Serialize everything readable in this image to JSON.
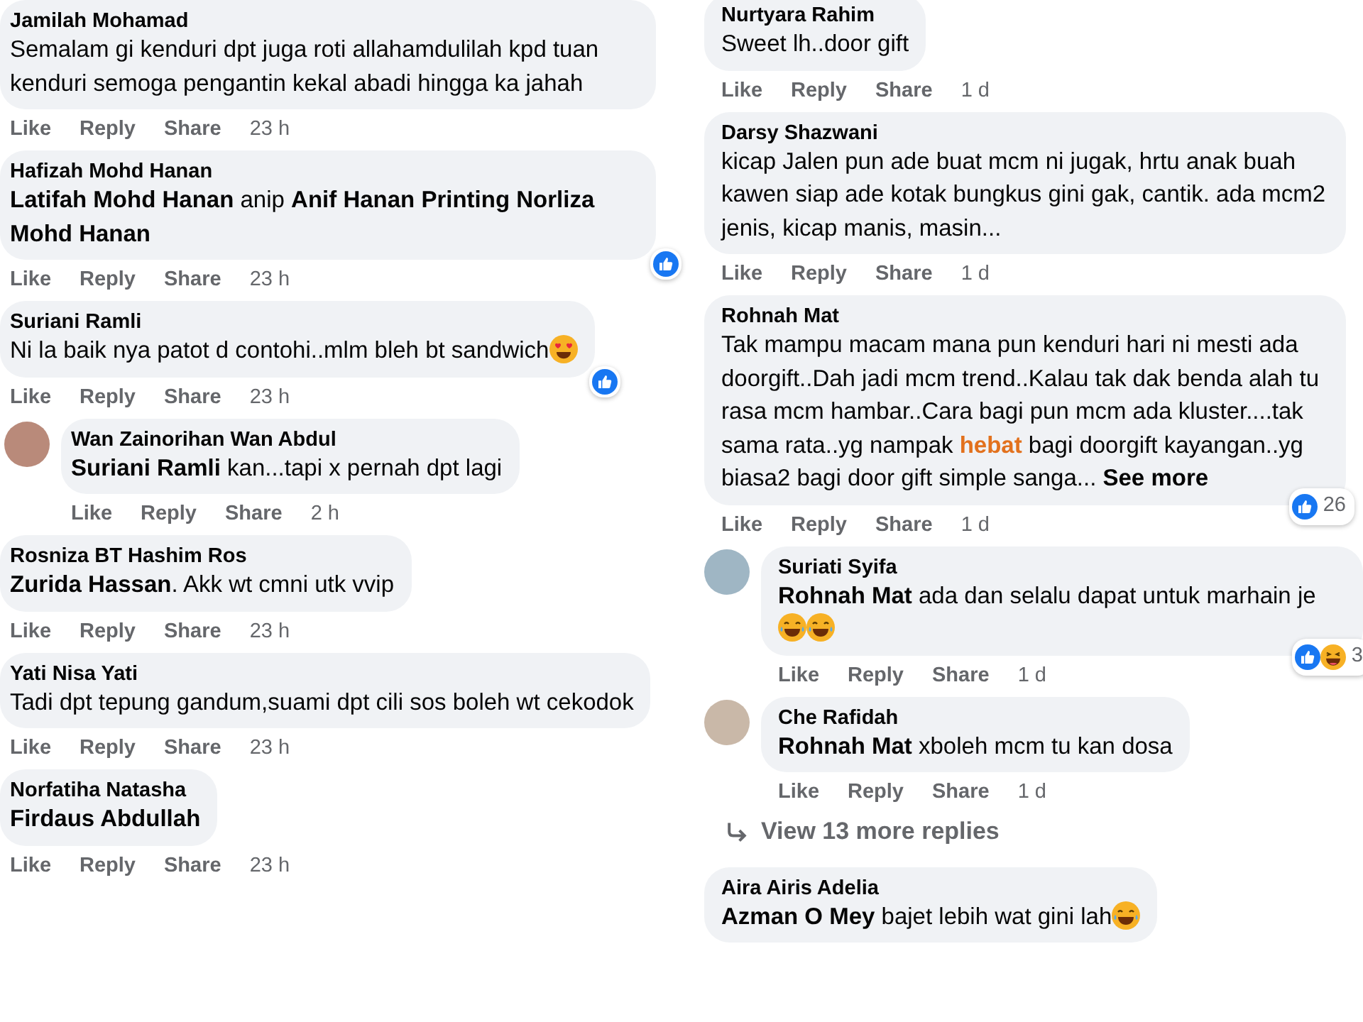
{
  "columns": [
    {
      "comments": [
        {
          "reply": false,
          "author": "Jamilah Mohamad",
          "text": [
            {
              "kind": "plain",
              "text": "Semalam gi kenduri dpt juga roti allahamdulilah kpd tuan kenduri semoga pengantin kekal abadi hingga ka jahah"
            }
          ],
          "actions": [
            "Like",
            "Reply",
            "Share"
          ],
          "time": "23 h"
        },
        {
          "reply": false,
          "author": "Hafizah Mohd Hanan",
          "text": [
            {
              "kind": "mention",
              "text": "Latifah Mohd Hanan"
            },
            {
              "kind": "plain",
              "text": " anip "
            },
            {
              "kind": "mention",
              "text": "Anif Hanan Printing Norliza Mohd Hanan"
            }
          ],
          "actions": [
            "Like",
            "Reply",
            "Share"
          ],
          "time": "23 h",
          "reactions": [
            {
              "kind": "like"
            }
          ]
        },
        {
          "reply": false,
          "author": "Suriani Ramli",
          "text": [
            {
              "kind": "plain",
              "text": "Ni la baik nya patot d contohi..mlm bleh bt sandwich"
            },
            {
              "kind": "heart_eyes_emoji"
            }
          ],
          "actions": [
            "Like",
            "Reply",
            "Share"
          ],
          "time": "23 h",
          "reactions": [
            {
              "kind": "like"
            }
          ]
        },
        {
          "reply": true,
          "author": "Wan Zainorihan Wan Abdul",
          "text": [
            {
              "kind": "mention",
              "text": "Suriani Ramli"
            },
            {
              "kind": "plain",
              "text": " kan...tapi x pernah dpt lagi"
            }
          ],
          "actions": [
            "Like",
            "Reply",
            "Share"
          ],
          "time": "2 h"
        },
        {
          "reply": false,
          "author": "Rosniza BT Hashim Ros",
          "text": [
            {
              "kind": "mention",
              "text": "Zurida Hassan"
            },
            {
              "kind": "plain",
              "text": ". Akk wt cmni utk vvip"
            }
          ],
          "actions": [
            "Like",
            "Reply",
            "Share"
          ],
          "time": "23 h"
        },
        {
          "reply": false,
          "author": "Yati Nisa Yati",
          "text": [
            {
              "kind": "plain",
              "text": "Tadi dpt tepung gandum,suami dpt cili sos boleh wt cekodok"
            }
          ],
          "actions": [
            "Like",
            "Reply",
            "Share"
          ],
          "time": "23 h"
        },
        {
          "reply": false,
          "author": "Norfatiha Natasha",
          "text": [
            {
              "kind": "mention",
              "text": "Firdaus Abdullah"
            }
          ],
          "actions": [
            "Like",
            "Reply",
            "Share"
          ],
          "time": "23 h"
        }
      ]
    },
    {
      "comments": [
        {
          "reply": false,
          "author": "Nurtyara Rahim",
          "text": [
            {
              "kind": "plain",
              "text": "Sweet lh..door gift"
            }
          ],
          "actions": [
            "Like",
            "Reply",
            "Share"
          ],
          "time": "1 d"
        },
        {
          "reply": false,
          "author": "Darsy Shazwani",
          "text": [
            {
              "kind": "plain",
              "text": "kicap Jalen pun ade buat mcm ni jugak, hrtu anak buah kawen siap ade kotak bungkus gini gak, cantik. ada mcm2 jenis, kicap manis, masin..."
            }
          ],
          "actions": [
            "Like",
            "Reply",
            "Share"
          ],
          "time": "1 d"
        },
        {
          "reply": false,
          "author": "Rohnah Mat",
          "text": [
            {
              "kind": "plain",
              "text": "Tak mampu macam mana pun kenduri hari ni mesti ada doorgift..Dah jadi mcm trend..Kalau tak dak benda alah tu rasa mcm hambar..Cara bagi pun mcm ada kluster....tak sama rata..yg nampak "
            },
            {
              "kind": "highlight",
              "text": "hebat"
            },
            {
              "kind": "plain",
              "text": " bagi doorgift kayangan..yg biasa2 bagi door gift simple sanga... "
            },
            {
              "kind": "see_more",
              "text": "See more"
            }
          ],
          "actions": [
            "Like",
            "Reply",
            "Share"
          ],
          "time": "1 d",
          "reactions": [
            {
              "kind": "like"
            }
          ],
          "reaction_count": "26"
        },
        {
          "reply": true,
          "author": "Suriati Syifa",
          "text": [
            {
              "kind": "mention",
              "text": "Rohnah Mat"
            },
            {
              "kind": "plain",
              "text": " ada dan selalu dapat untuk marhain je "
            },
            {
              "kind": "laugh_emoji"
            },
            {
              "kind": "laugh_emoji"
            }
          ],
          "actions": [
            "Like",
            "Reply",
            "Share"
          ],
          "time": "1 d",
          "reactions": [
            {
              "kind": "like"
            },
            {
              "kind": "haha"
            }
          ],
          "reaction_count": "3"
        },
        {
          "reply": true,
          "author": "Che Rafidah",
          "text": [
            {
              "kind": "mention",
              "text": "Rohnah Mat"
            },
            {
              "kind": "plain",
              "text": " xboleh mcm tu kan dosa"
            }
          ],
          "actions": [
            "Like",
            "Reply",
            "Share"
          ],
          "time": "1 d"
        },
        {
          "kind": "more_replies",
          "label": "View 13 more replies"
        },
        {
          "reply": false,
          "author": "Aira Airis Adelia",
          "text": [
            {
              "kind": "mention",
              "text": "Azman O Mey"
            },
            {
              "kind": "plain",
              "text": " bajet lebih wat gini lah"
            },
            {
              "kind": "laugh_emoji"
            }
          ]
        }
      ]
    }
  ]
}
